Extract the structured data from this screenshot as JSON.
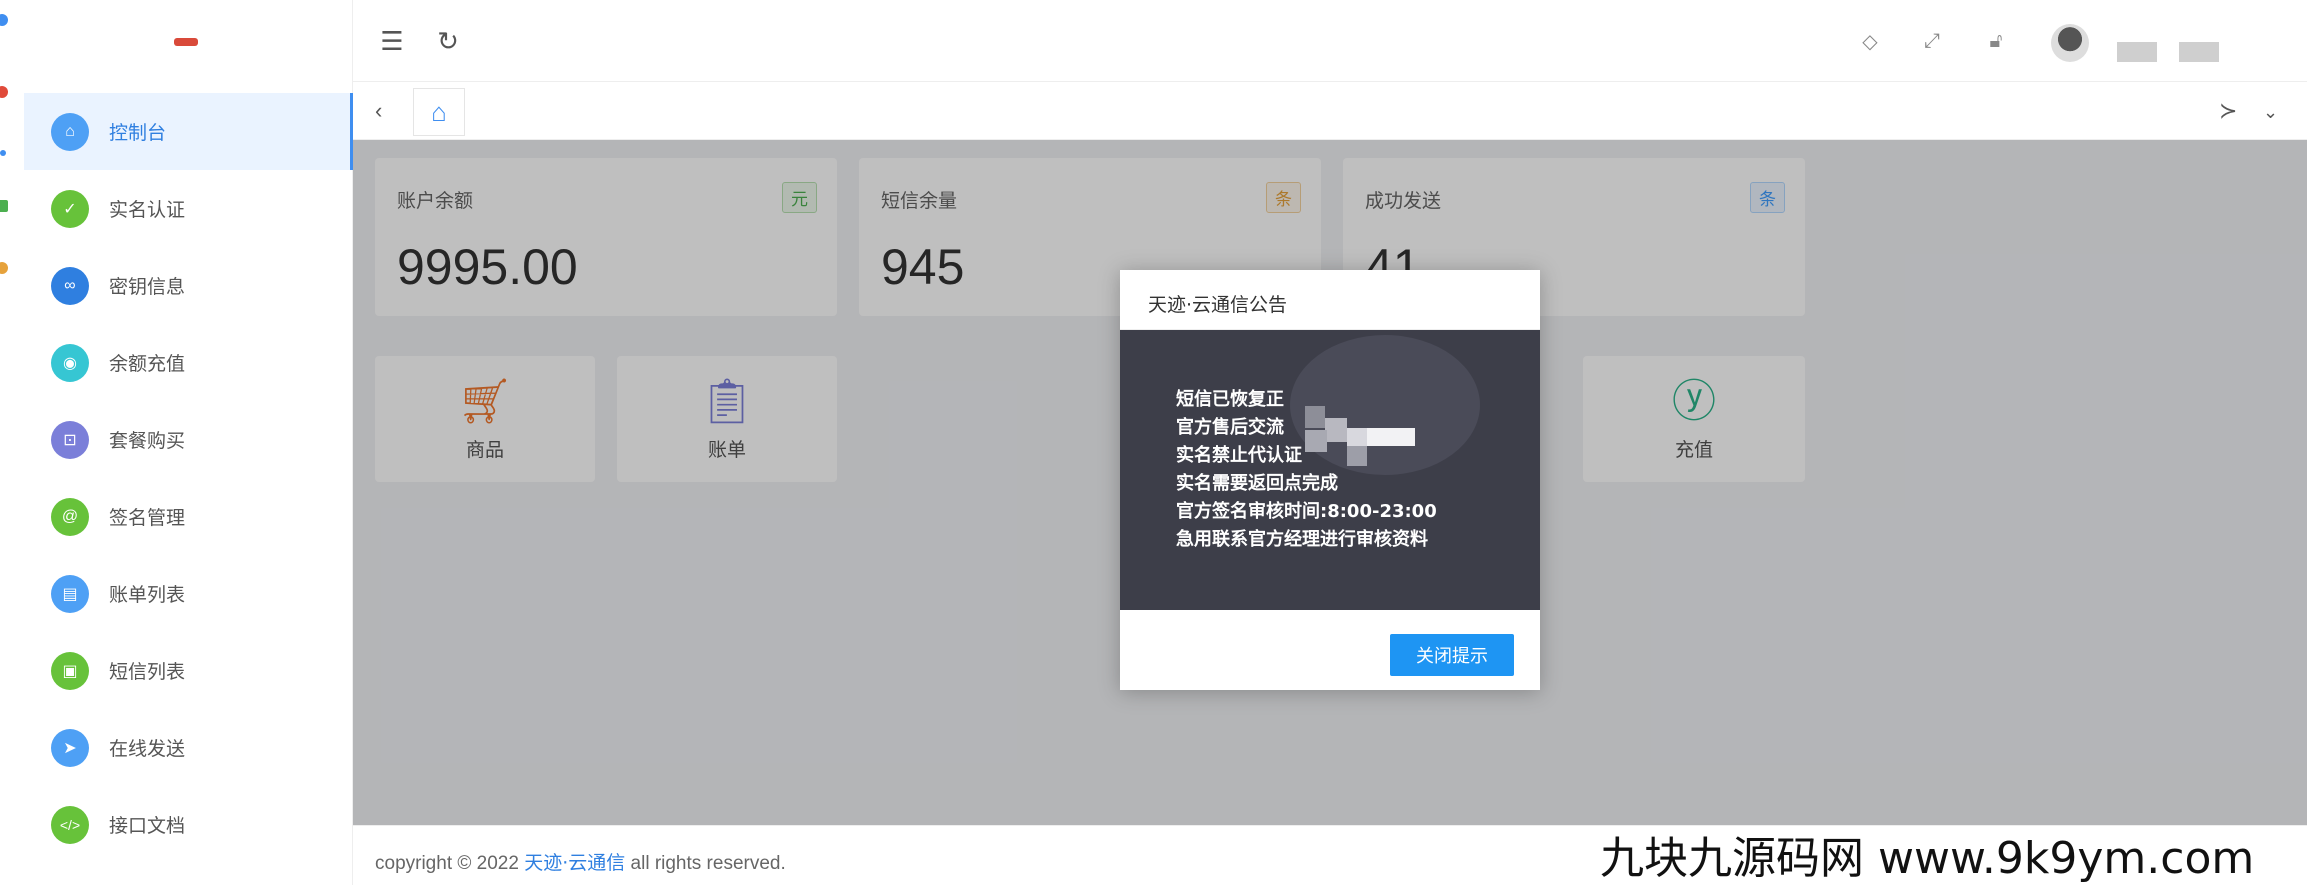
{
  "colors": {
    "accent": "#3f8ef0",
    "sidebar_active_bg": "#eaf3ff",
    "modal_body_bg": "#3d3e49",
    "modal_button": "#1e95f3",
    "tag_yuan": "#4caf50",
    "tag_tiao_orange": "#e6a23c",
    "tag_tiao_blue": "#409eff"
  },
  "sidebar": {
    "items": [
      {
        "label": "控制台",
        "icon": "home-icon",
        "color": "#4ea0f5",
        "active": true
      },
      {
        "label": "实名认证",
        "icon": "check-shield-icon",
        "color": "#67c23a"
      },
      {
        "label": "密钥信息",
        "icon": "link-icon",
        "color": "#2f7fe0"
      },
      {
        "label": "余额充值",
        "icon": "coin-icon",
        "color": "#36c6d3"
      },
      {
        "label": "套餐购买",
        "icon": "cart-icon",
        "color": "#7b7fd9"
      },
      {
        "label": "签名管理",
        "icon": "at-icon",
        "color": "#67c23a"
      },
      {
        "label": "账单列表",
        "icon": "document-icon",
        "color": "#4ea0f5"
      },
      {
        "label": "短信列表",
        "icon": "sms-icon",
        "color": "#67c23a"
      },
      {
        "label": "在线发送",
        "icon": "send-icon",
        "color": "#4ea0f5"
      },
      {
        "label": "接口文档",
        "icon": "code-icon",
        "color": "#67c23a"
      }
    ]
  },
  "header": {
    "collapse_icon": "menu-collapse-icon",
    "refresh_icon": "refresh-icon",
    "right_icons": [
      "tag-icon",
      "fullscreen-icon",
      "lock-icon"
    ]
  },
  "stats": [
    {
      "title": "账户余额",
      "tag": "元",
      "value": "9995.00"
    },
    {
      "title": "短信余量",
      "tag": "条",
      "value": "945"
    },
    {
      "title": "成功发送",
      "tag": "条",
      "value": "41"
    }
  ],
  "quick_links": [
    {
      "label": "商品",
      "icon": "cart-icon"
    },
    {
      "label": "账单",
      "icon": "clipboard-icon"
    },
    {
      "label": "充值",
      "icon": "yen-icon"
    }
  ],
  "footer": {
    "prefix": "copyright © 2022 ",
    "brand": "天迹·云通信",
    "suffix": " all rights reserved."
  },
  "modal": {
    "title": "天迹·云通信公告",
    "lines": [
      "短信已恢复正",
      "官方售后交流",
      "实名禁止代认证",
      "实名需要返回点完成",
      "官方签名审核时间:8:00-23:00",
      "急用联系官方经理进行审核资料"
    ],
    "close_label": "关闭提示"
  },
  "watermark": "九块九源码网 www.9k9ym.com"
}
